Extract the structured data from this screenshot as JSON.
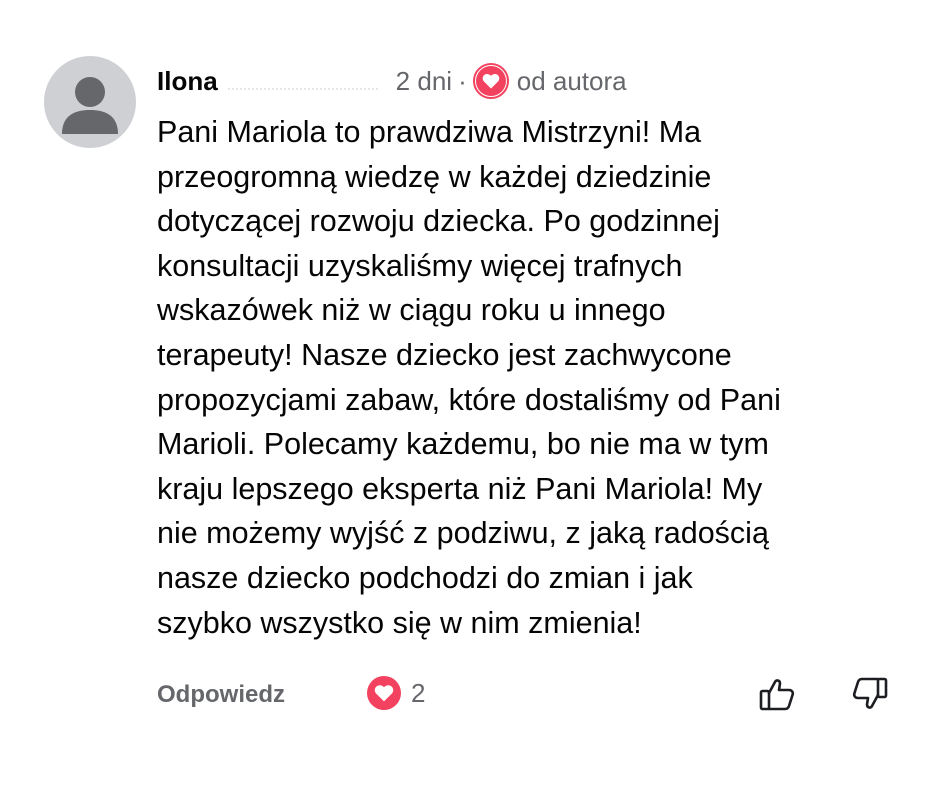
{
  "comment": {
    "author": "Ilona",
    "time": "2 dni",
    "separator": "·",
    "author_reaction_label": "od autora",
    "text_lines": [
      "Pani Mariola to prawdziwa Mistrzyni! Ma",
      "przeogromną wiedzę w każdej dziedzinie",
      "dotyczącej rozwoju dziecka. Po godzinnej",
      "konsultacji uzyskaliśmy więcej trafnych",
      "wskazówek niż w ciągu roku u innego",
      "terapeuty! Nasze dziecko jest zachwycone",
      "propozycjami zabaw, które dostaliśmy od Pani",
      "Marioli. Polecamy każdemu, bo nie ma w tym",
      "kraju lepszego eksperta niż Pani Mariola! My",
      "nie możemy wyjść z podziwu, z jaką radością",
      "nasze dziecko podchodzi do zmian i jak",
      "szybko wszystko się w nim zmienia!"
    ]
  },
  "actions": {
    "reply_label": "Odpowiedz",
    "reaction_count": "2",
    "reaction_icon": "heart-icon",
    "upvote_icon": "thumbs-up-icon",
    "downvote_icon": "thumbs-down-icon"
  },
  "colors": {
    "heart": "#f3425f",
    "secondary_text": "#65676b",
    "avatar_bg": "#ced0d4"
  }
}
